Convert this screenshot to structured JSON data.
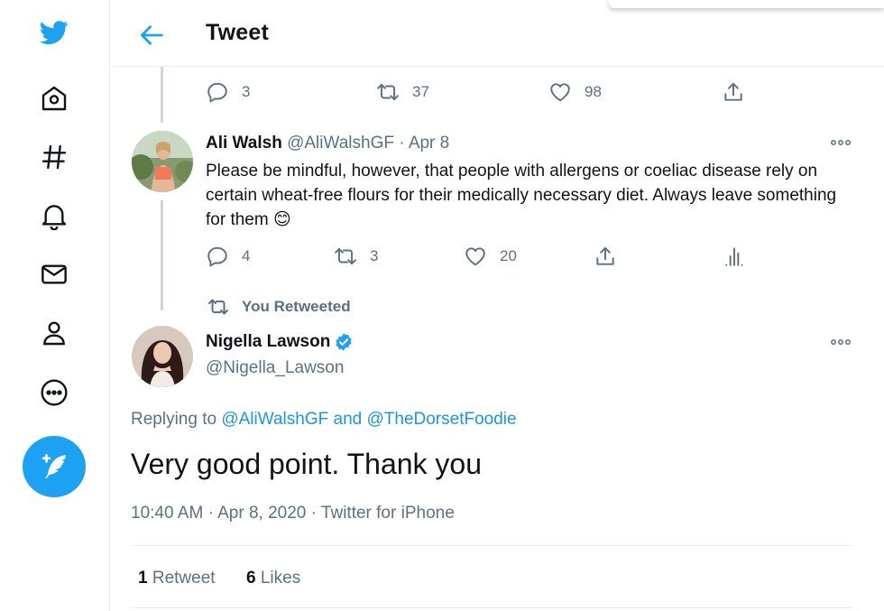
{
  "header": {
    "title": "Tweet"
  },
  "nav": {
    "items": [
      "twitter-logo",
      "home",
      "explore",
      "notifications",
      "messages",
      "profile",
      "more"
    ]
  },
  "prev_tweet_actions": {
    "replies": "3",
    "retweets": "37",
    "likes": "98"
  },
  "reply_tweet": {
    "name": "Ali Walsh",
    "handle": "@AliWalshGF",
    "separator": "·",
    "date": "Apr 8",
    "text": "Please be mindful, however, that people with allergens or coeliac disease rely on certain wheat-free flours for their medically necessary diet. Always leave something for them",
    "emoji": "😊",
    "replies": "4",
    "retweets": "3",
    "likes": "20"
  },
  "retweet_notice": "You Retweeted",
  "main_tweet": {
    "name": "Nigella Lawson",
    "handle": "@Nigella_Lawson",
    "replying_prefix": "Replying to",
    "replying_user1": "@AliWalshGF",
    "replying_and": "and",
    "replying_user2": "@TheDorsetFoodie",
    "text": "Very good point. Thank you",
    "time": "10:40 AM",
    "dot": "·",
    "date": "Apr 8, 2020",
    "source": "Twitter for iPhone",
    "retweet_count": "1",
    "retweet_label": "Retweet",
    "like_count": "6",
    "like_label": "Likes"
  },
  "colors": {
    "accent": "#1da1f2",
    "muted": "#5b7083",
    "link": "#1b95e0"
  }
}
